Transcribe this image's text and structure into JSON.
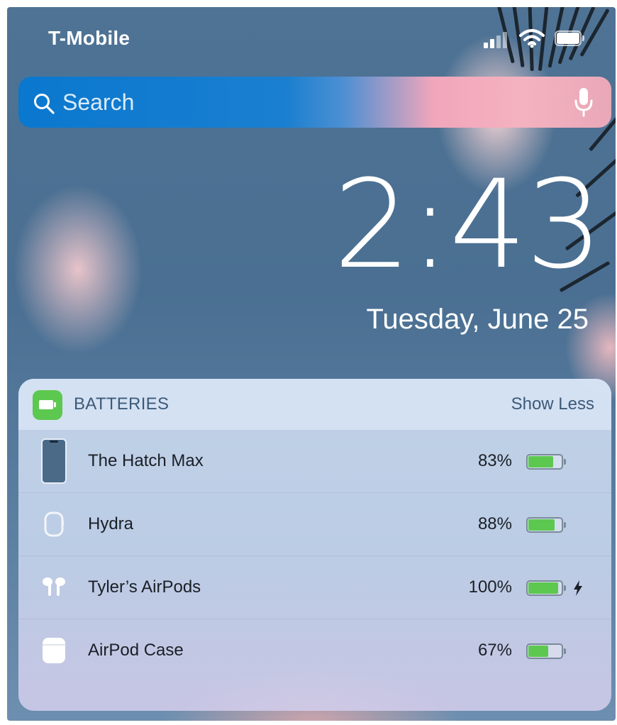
{
  "status_bar": {
    "carrier": "T-Mobile",
    "signal_icon": "signal-bars-icon",
    "wifi_icon": "wifi-icon",
    "battery_icon": "battery-icon"
  },
  "search": {
    "placeholder": "Search",
    "value": "",
    "icon": "search-icon",
    "mic_icon": "microphone-icon"
  },
  "lock": {
    "time": "2:43",
    "date": "Tuesday, June 25"
  },
  "widget": {
    "title": "BATTERIES",
    "toggle_label": "Show Less",
    "app_icon": "batteries-app-icon",
    "accent_color": "#5dc84f",
    "devices": [
      {
        "name": "The Hatch Max",
        "percent_label": "83%",
        "level": 0.83,
        "icon": "iphone-icon",
        "charging": false
      },
      {
        "name": "Hydra",
        "percent_label": "88%",
        "level": 0.88,
        "icon": "apple-watch-icon",
        "charging": false
      },
      {
        "name": "Tyler’s AirPods",
        "percent_label": "100%",
        "level": 1.0,
        "icon": "airpods-icon",
        "charging": true
      },
      {
        "name": "AirPod Case",
        "percent_label": "67%",
        "level": 0.67,
        "icon": "airpod-case-icon",
        "charging": false
      }
    ]
  }
}
